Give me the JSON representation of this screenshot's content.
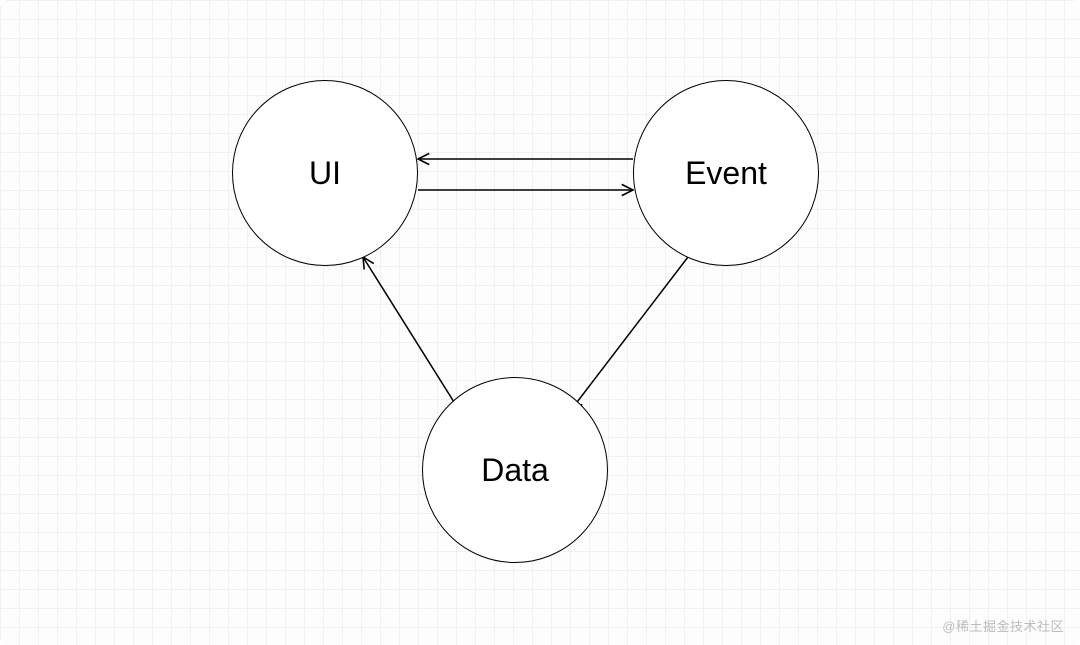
{
  "diagram": {
    "nodes": {
      "ui": {
        "label": "UI"
      },
      "event": {
        "label": "Event"
      },
      "data": {
        "label": "Data"
      }
    },
    "edges": [
      {
        "from": "ui",
        "to": "event"
      },
      {
        "from": "event",
        "to": "ui"
      },
      {
        "from": "event",
        "to": "data"
      },
      {
        "from": "data",
        "to": "ui"
      }
    ]
  },
  "watermark": "@稀土掘金技术社区"
}
